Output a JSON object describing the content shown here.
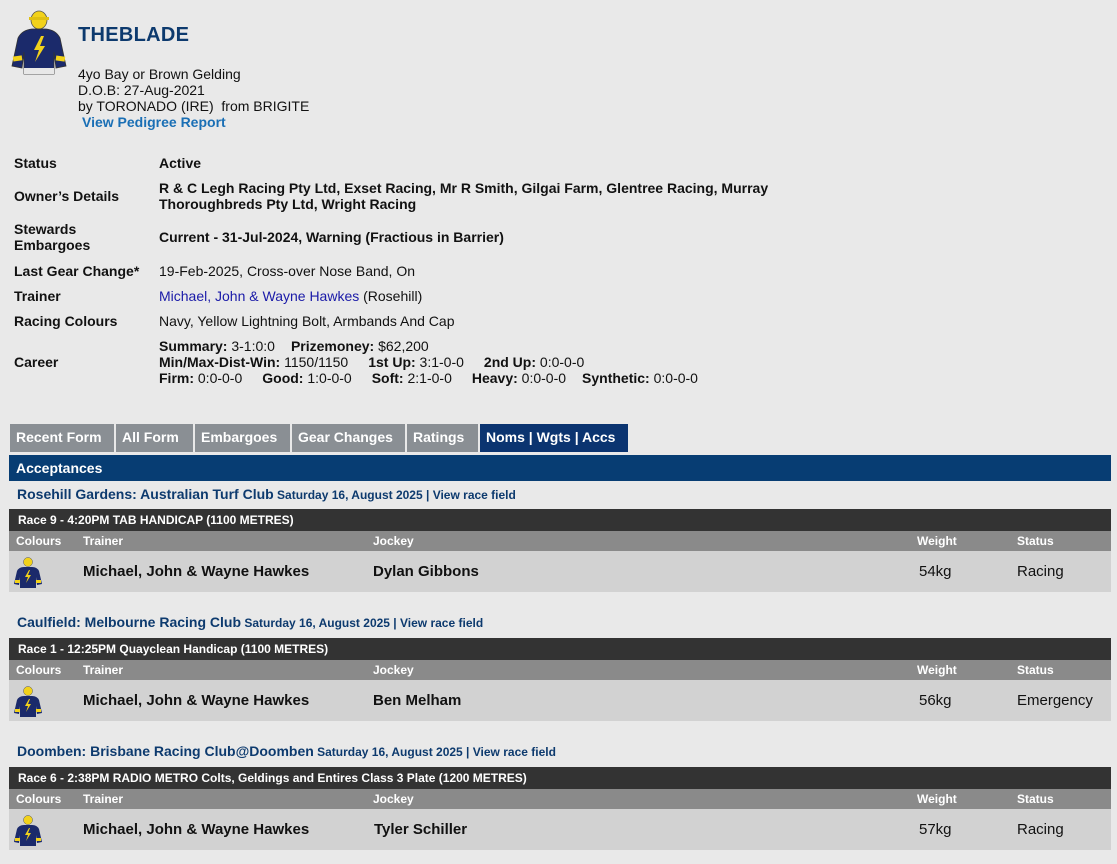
{
  "horse": {
    "name": "THEBLADE",
    "description": "4yo Bay or Brown Gelding",
    "dob": "D.O.B: 27-Aug-2021",
    "breeding": "by TORONADO (IRE)  from BRIGITE",
    "pedigree_link": "View Pedigree Report",
    "silks_icon": "jockey-silks-navy-yellow-bolt"
  },
  "details": {
    "status_label": "Status",
    "status_value": "Active",
    "owner_label": "Owner’s Details",
    "owner_value": "R & C Legh Racing Pty Ltd, Exset Racing, Mr R Smith, Gilgai Farm, Glentree Racing, Murray Thoroughbreds Pty Ltd, Wright Racing",
    "stewards_label": "Stewards Embargoes",
    "stewards_value": "Current - 31-Jul-2024, Warning (Fractious in Barrier)",
    "gear_label": "Last Gear Change*",
    "gear_value": "19-Feb-2025, Cross-over Nose Band, On",
    "trainer_label": "Trainer",
    "trainer_name": "Michael, John & Wayne Hawkes",
    "trainer_location": " (Rosehill)",
    "colours_label": "Racing Colours",
    "colours_value": "Navy, Yellow Lightning Bolt, Armbands And Cap",
    "career_label": "Career",
    "career": {
      "summary_label": "Summary:",
      "summary": "3-1:0:0",
      "prize_label": "Prizemoney:",
      "prize": "$62,200",
      "mmdw_label": "Min/Max-Dist-Win:",
      "mmdw": "1150/1150",
      "first_up_label": "1st Up:",
      "first_up": "3:1-0-0",
      "second_up_label": "2nd Up:",
      "second_up": "0:0-0-0",
      "firm_label": "Firm:",
      "firm": "0:0-0-0",
      "good_label": "Good:",
      "good": "1:0-0-0",
      "soft_label": "Soft:",
      "soft": "2:1-0-0",
      "heavy_label": "Heavy:",
      "heavy": "0:0-0-0",
      "synthetic_label": "Synthetic:",
      "synthetic": "0:0-0-0"
    }
  },
  "tabs": [
    {
      "label": "Recent Form"
    },
    {
      "label": "All Form"
    },
    {
      "label": "Embargoes"
    },
    {
      "label": "Gear Changes"
    },
    {
      "label": "Ratings"
    },
    {
      "label": "Noms | Wgts | Accs"
    }
  ],
  "section_title": "Acceptances",
  "columns": {
    "colours": "Colours",
    "trainer": "Trainer",
    "jockey": "Jockey",
    "weight": "Weight",
    "status": "Status"
  },
  "meetings": [
    {
      "venue": "Rosehill Gardens: Australian Turf Club",
      "date": " Saturday 16, August 2025 | ",
      "view_field": "View race field",
      "race": "Race 9 - 4:20PM TAB HANDICAP (1100 METRES)",
      "trainer": "Michael, John & Wayne Hawkes",
      "jockey": "Dylan Gibbons",
      "weight": "54kg",
      "status": "Racing"
    },
    {
      "venue": "Caulfield: Melbourne Racing Club",
      "date": " Saturday 16, August 2025 | ",
      "view_field": "View race field",
      "race": "Race 1 - 12:25PM Quayclean Handicap (1100 METRES)",
      "trainer": "Michael, John & Wayne Hawkes",
      "jockey": "Ben Melham",
      "weight": "56kg",
      "status": "Emergency"
    },
    {
      "venue": "Doomben: Brisbane Racing Club@Doomben",
      "date": " Saturday 16, August 2025 | ",
      "view_field": "View race field",
      "race": "Race 6 - 2:38PM RADIO METRO Colts, Geldings and Entires Class 3 Plate (1200 METRES)",
      "trainer": "Michael, John & Wayne Hawkes",
      "jockey": "Tyler Schiller",
      "weight": "57kg",
      "status": "Racing"
    }
  ],
  "colors": {
    "navy": "#0b3470",
    "tab_grey": "#8a8f94",
    "race_bar": "#333333",
    "silks_yellow": "#f2d21b"
  }
}
